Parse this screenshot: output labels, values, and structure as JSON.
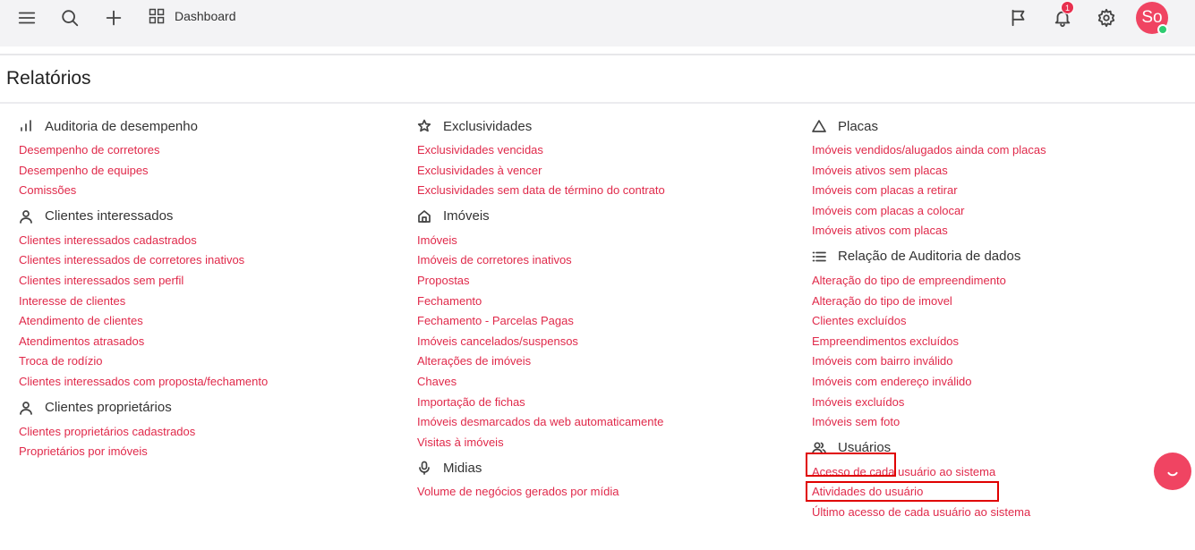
{
  "topbar": {
    "dashboard_label": "Dashboard",
    "notification_count": "1",
    "avatar_initials": "So"
  },
  "page": {
    "title": "Relatórios"
  },
  "colors": {
    "accent": "#e0294a",
    "avatar": "#f04462",
    "online": "#2ecc71",
    "highlight": "#e00000"
  },
  "sections": {
    "auditoria": {
      "title": "Auditoria de desempenho",
      "icon": "bar-chart-icon",
      "items": [
        "Desempenho de corretores",
        "Desempenho de equipes",
        "Comissões"
      ]
    },
    "clientes_interessados": {
      "title": "Clientes interessados",
      "icon": "person-icon",
      "items": [
        "Clientes interessados cadastrados",
        "Clientes interessados de corretores inativos",
        "Clientes interessados sem perfil",
        "Interesse de clientes",
        "Atendimento de clientes",
        "Atendimentos atrasados",
        "Troca de rodízio",
        "Clientes interessados com proposta/fechamento"
      ]
    },
    "clientes_proprietarios": {
      "title": "Clientes proprietários",
      "icon": "person-icon",
      "items": [
        "Clientes proprietários cadastrados",
        "Proprietários por imóveis"
      ]
    },
    "exclusividades": {
      "title": "Exclusividades",
      "icon": "star-icon",
      "items": [
        "Exclusividades vencidas",
        "Exclusividades à vencer",
        "Exclusividades sem data de término do contrato"
      ]
    },
    "imoveis": {
      "title": "Imóveis",
      "icon": "home-icon",
      "items": [
        "Imóveis",
        "Imóveis de corretores inativos",
        "Propostas",
        "Fechamento",
        "Fechamento - Parcelas Pagas",
        "Imóveis cancelados/suspensos",
        "Alterações de imóveis",
        "Chaves",
        "Importação de fichas",
        "Imóveis desmarcados da web automaticamente",
        "Visitas à imóveis"
      ]
    },
    "midias": {
      "title": "Midias",
      "icon": "microphone-icon",
      "items": [
        "Volume de negócios gerados por mídia"
      ]
    },
    "placas": {
      "title": "Placas",
      "icon": "triangle-icon",
      "items": [
        "Imóveis vendidos/alugados ainda com placas",
        "Imóveis ativos sem placas",
        "Imóveis com placas a retirar",
        "Imóveis com placas a colocar",
        "Imóveis ativos com placas"
      ]
    },
    "relacao_auditoria": {
      "title": "Relação de Auditoria de dados",
      "icon": "list-icon",
      "items": [
        "Alteração do tipo de empreendimento",
        "Alteração do tipo de imovel",
        "Clientes excluídos",
        "Empreendimentos excluídos",
        "Imóveis com bairro inválido",
        "Imóveis com endereço inválido",
        "Imóveis excluídos",
        "Imóveis sem foto"
      ]
    },
    "usuarios": {
      "title": "Usuários",
      "icon": "users-icon",
      "items": [
        "Acesso de cada usuário ao sistema",
        "Atividades do usuário",
        "Último acesso de cada usuário ao sistema"
      ]
    }
  }
}
